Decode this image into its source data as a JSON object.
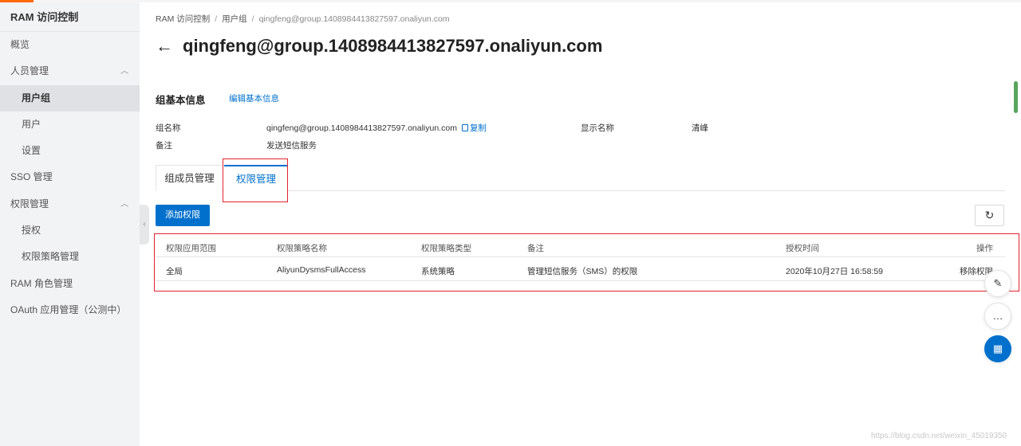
{
  "sidebar": {
    "title": "RAM 访问控制",
    "items": [
      {
        "label": "概览"
      },
      {
        "label": "人员管理"
      },
      {
        "label": "用户组"
      },
      {
        "label": "用户"
      },
      {
        "label": "设置"
      },
      {
        "label": "SSO 管理"
      },
      {
        "label": "权限管理"
      },
      {
        "label": "授权"
      },
      {
        "label": "权限策略管理"
      },
      {
        "label": "RAM 角色管理"
      },
      {
        "label": "OAuth 应用管理（公测中）"
      }
    ]
  },
  "breadcrumb": {
    "home": "RAM 访问控制",
    "group": "用户组",
    "current": "qingfeng@group.1408984413827597.onaliyun.com"
  },
  "page": {
    "back_glyph": "←",
    "title": "qingfeng@group.1408984413827597.onaliyun.com"
  },
  "basic_info": {
    "section_title": "组基本信息",
    "edit_label": "编辑基本信息",
    "group_name_label": "组名称",
    "group_name_value": "qingfeng@group.1408984413827597.onaliyun.com",
    "copy_label": "复制",
    "display_name_label": "显示名称",
    "display_name_value": "清峰",
    "remark_label": "备注",
    "remark_value": "发送短信服务"
  },
  "tabs": [
    {
      "label": "组成员管理"
    },
    {
      "label": "权限管理"
    }
  ],
  "toolbar": {
    "add_label": "添加权限",
    "refresh_glyph": "↻"
  },
  "table": {
    "headers": [
      "权限应用范围",
      "权限策略名称",
      "权限策略类型",
      "备注",
      "授权时间",
      "操作"
    ],
    "rows": [
      {
        "scope": "全局",
        "policy_name": "AliyunDysmsFullAccess",
        "policy_type": "系统策略",
        "remark": "管理短信服务（SMS）的权限",
        "time": "2020年10月27日 16:58:59",
        "action": "移除权限"
      }
    ]
  },
  "float_buttons": {
    "notes_glyph": "✎",
    "chat_glyph": "…",
    "apps_glyph": "▦"
  },
  "watermark": "https://blog.csdn.net/weixin_45019350",
  "colors": {
    "accent": "#0070cc",
    "brand": "#ff6a00",
    "highlight": "#e0252d"
  }
}
